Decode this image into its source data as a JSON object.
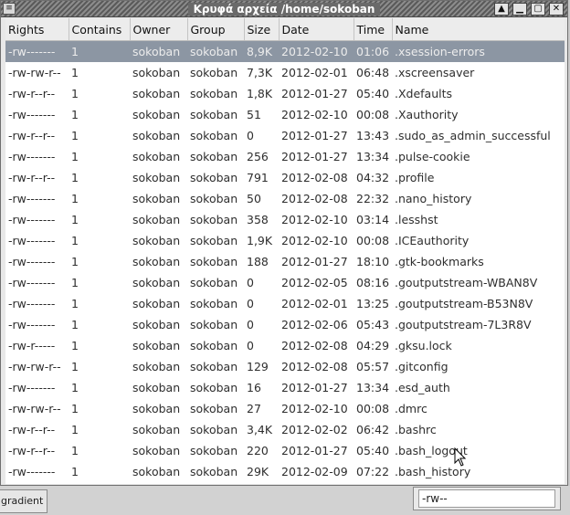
{
  "window": {
    "title": "Κρυφά αρχεία /home/sokoban"
  },
  "columns": [
    "Rights",
    "Contains",
    "Owner",
    "Group",
    "Size",
    "Date",
    "Time",
    "Name"
  ],
  "rows": [
    {
      "rights": "-rw-------",
      "contains": "1",
      "owner": "sokoban",
      "group": "sokoban",
      "size": "8,9K",
      "date": "2012-02-10",
      "time": "01:06",
      "name": ".xsession-errors"
    },
    {
      "rights": "-rw-rw-r--",
      "contains": "1",
      "owner": "sokoban",
      "group": "sokoban",
      "size": "7,3K",
      "date": "2012-02-01",
      "time": "06:48",
      "name": ".xscreensaver"
    },
    {
      "rights": "-rw-r--r--",
      "contains": "1",
      "owner": "sokoban",
      "group": "sokoban",
      "size": "1,8K",
      "date": "2012-01-27",
      "time": "05:40",
      "name": ".Xdefaults"
    },
    {
      "rights": "-rw-------",
      "contains": "1",
      "owner": "sokoban",
      "group": "sokoban",
      "size": "51",
      "date": "2012-02-10",
      "time": "00:08",
      "name": ".Xauthority"
    },
    {
      "rights": "-rw-r--r--",
      "contains": "1",
      "owner": "sokoban",
      "group": "sokoban",
      "size": "0",
      "date": "2012-01-27",
      "time": "13:43",
      "name": ".sudo_as_admin_successful"
    },
    {
      "rights": "-rw-------",
      "contains": "1",
      "owner": "sokoban",
      "group": "sokoban",
      "size": "256",
      "date": "2012-01-27",
      "time": "13:34",
      "name": ".pulse-cookie"
    },
    {
      "rights": "-rw-r--r--",
      "contains": "1",
      "owner": "sokoban",
      "group": "sokoban",
      "size": "791",
      "date": "2012-02-08",
      "time": "04:32",
      "name": ".profile"
    },
    {
      "rights": "-rw-------",
      "contains": "1",
      "owner": "sokoban",
      "group": "sokoban",
      "size": "50",
      "date": "2012-02-08",
      "time": "22:32",
      "name": ".nano_history"
    },
    {
      "rights": "-rw-------",
      "contains": "1",
      "owner": "sokoban",
      "group": "sokoban",
      "size": "358",
      "date": "2012-02-10",
      "time": "03:14",
      "name": ".lesshst"
    },
    {
      "rights": "-rw-------",
      "contains": "1",
      "owner": "sokoban",
      "group": "sokoban",
      "size": "1,9K",
      "date": "2012-02-10",
      "time": "00:08",
      "name": ".ICEauthority"
    },
    {
      "rights": "-rw-------",
      "contains": "1",
      "owner": "sokoban",
      "group": "sokoban",
      "size": "188",
      "date": "2012-01-27",
      "time": "18:10",
      "name": ".gtk-bookmarks"
    },
    {
      "rights": "-rw-------",
      "contains": "1",
      "owner": "sokoban",
      "group": "sokoban",
      "size": "0",
      "date": "2012-02-05",
      "time": "08:16",
      "name": ".goutputstream-WBAN8V"
    },
    {
      "rights": "-rw-------",
      "contains": "1",
      "owner": "sokoban",
      "group": "sokoban",
      "size": "0",
      "date": "2012-02-01",
      "time": "13:25",
      "name": ".goutputstream-B53N8V"
    },
    {
      "rights": "-rw-------",
      "contains": "1",
      "owner": "sokoban",
      "group": "sokoban",
      "size": "0",
      "date": "2012-02-06",
      "time": "05:43",
      "name": ".goutputstream-7L3R8V"
    },
    {
      "rights": "-rw-r-----",
      "contains": "1",
      "owner": "sokoban",
      "group": "sokoban",
      "size": "0",
      "date": "2012-02-08",
      "time": "04:29",
      "name": ".gksu.lock"
    },
    {
      "rights": "-rw-rw-r--",
      "contains": "1",
      "owner": "sokoban",
      "group": "sokoban",
      "size": "129",
      "date": "2012-02-08",
      "time": "05:57",
      "name": ".gitconfig"
    },
    {
      "rights": "-rw-------",
      "contains": "1",
      "owner": "sokoban",
      "group": "sokoban",
      "size": "16",
      "date": "2012-01-27",
      "time": "13:34",
      "name": ".esd_auth"
    },
    {
      "rights": "-rw-rw-r--",
      "contains": "1",
      "owner": "sokoban",
      "group": "sokoban",
      "size": "27",
      "date": "2012-02-10",
      "time": "00:08",
      "name": ".dmrc"
    },
    {
      "rights": "-rw-r--r--",
      "contains": "1",
      "owner": "sokoban",
      "group": "sokoban",
      "size": "3,4K",
      "date": "2012-02-02",
      "time": "06:42",
      "name": ".bashrc"
    },
    {
      "rights": "-rw-r--r--",
      "contains": "1",
      "owner": "sokoban",
      "group": "sokoban",
      "size": "220",
      "date": "2012-01-27",
      "time": "05:40",
      "name": ".bash_logout"
    },
    {
      "rights": "-rw-------",
      "contains": "1",
      "owner": "sokoban",
      "group": "sokoban",
      "size": "29K",
      "date": "2012-02-09",
      "time": "07:22",
      "name": ".bash_history"
    }
  ],
  "selected_row": 0,
  "statusbar": {
    "gradient_label": "gradient"
  },
  "filter": {
    "value": "-rw--"
  },
  "titlebar_buttons": {
    "left": "≡",
    "up": "▲",
    "minimize": "▁",
    "maximize": "▢",
    "close": "✕"
  }
}
